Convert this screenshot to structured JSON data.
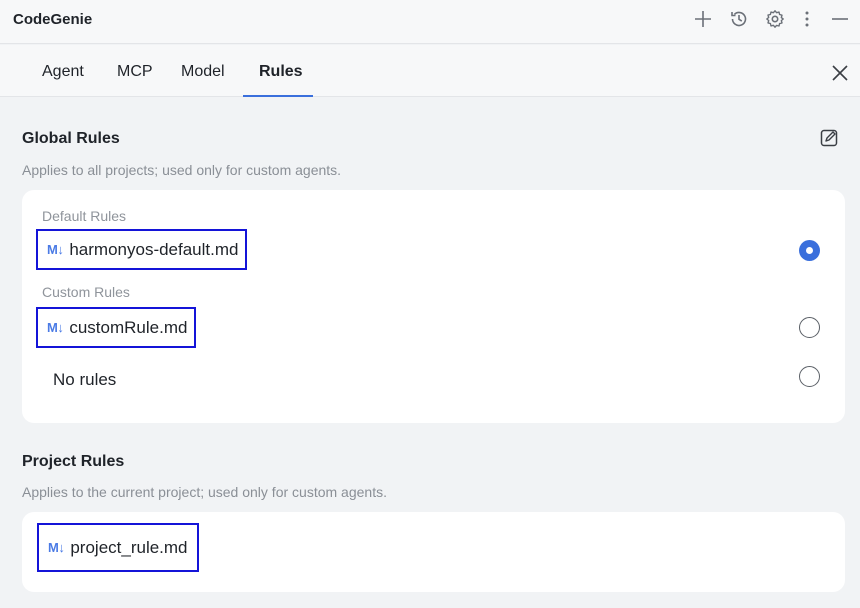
{
  "app": {
    "title": "CodeGenie"
  },
  "toolbar": {
    "icons": [
      "plus-icon",
      "history-icon",
      "gear-icon",
      "more-vertical-icon",
      "minimize-icon"
    ]
  },
  "tabs": [
    {
      "label": "Agent",
      "active": false
    },
    {
      "label": "MCP",
      "active": false
    },
    {
      "label": "Model",
      "active": false
    },
    {
      "label": "Rules",
      "active": true
    }
  ],
  "global_rules": {
    "title": "Global Rules",
    "description": "Applies to all projects; used only for custom agents.",
    "default_group_label": "Default Rules",
    "custom_group_label": "Custom Rules",
    "items": [
      {
        "icon": "M↓",
        "label": "harmonyos-default.md",
        "selected": true
      },
      {
        "icon": "M↓",
        "label": "customRule.md",
        "selected": false
      },
      {
        "label": "No rules",
        "selected": false
      }
    ]
  },
  "project_rules": {
    "title": "Project Rules",
    "description": "Applies to the current project; used only for custom agents.",
    "items": [
      {
        "icon": "M↓",
        "label": "project_rule.md"
      }
    ]
  },
  "colors": {
    "accent": "#3a6fdc",
    "highlight_box": "#1414d8",
    "md_icon": "#4b7be5"
  }
}
